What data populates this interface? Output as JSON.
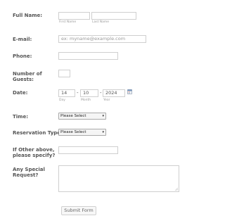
{
  "form": {
    "full_name": {
      "label": "Full Name:",
      "first_value": "",
      "last_value": "",
      "first_sublabel": "First Name",
      "last_sublabel": "Last Name"
    },
    "email": {
      "label": "E-mail:",
      "placeholder": "ex: myname@example.com"
    },
    "phone": {
      "label": "Phone:",
      "value": ""
    },
    "guests": {
      "label_line1": "Number of",
      "label_line2": "Guests:",
      "value": ""
    },
    "date": {
      "label": "Date:",
      "day": "14",
      "month": "10",
      "year": "2024",
      "separator": "-",
      "day_sublabel": "Day",
      "month_sublabel": "Month",
      "year_sublabel": "Year",
      "icon": "calendar-icon"
    },
    "time": {
      "label": "Time:",
      "selected": "Please Select"
    },
    "reservation_type": {
      "label": "Reservation Type:",
      "selected": "Please Select"
    },
    "other": {
      "label_line1": "If Other above,",
      "label_line2": "please specify?",
      "value": ""
    },
    "special_request": {
      "label_line1": "Any Special",
      "label_line2": "Request?",
      "value": ""
    },
    "submit_label": "Submit Form"
  }
}
